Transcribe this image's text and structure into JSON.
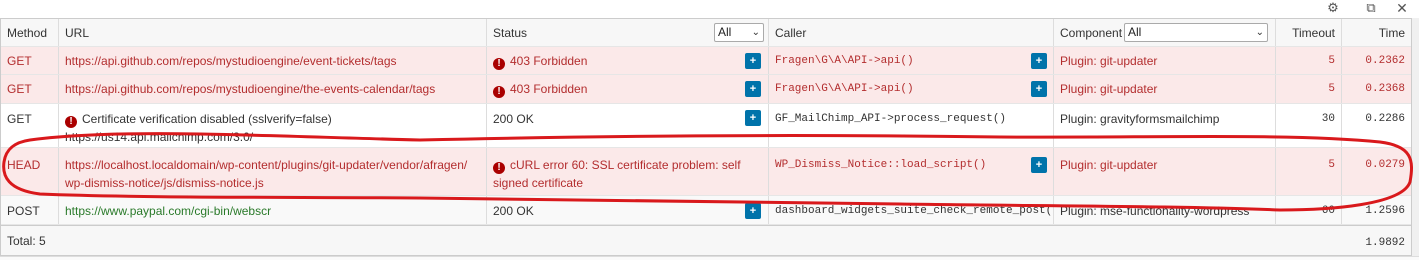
{
  "window_controls": {
    "settings": "⚙",
    "popout": "⧉",
    "close": "✕"
  },
  "columns": {
    "method": "Method",
    "url": "URL",
    "status": "Status",
    "status_filter": "All",
    "caller": "Caller",
    "component": "Component",
    "component_filter": "All",
    "timeout": "Timeout",
    "time": "Time"
  },
  "rows": [
    {
      "method": "GET",
      "url": "https://api.github.com/repos/mystudioengine/event-tickets/tags",
      "status": "403 Forbidden",
      "caller": "Fragen\\G\\A\\API->api()",
      "component": "Plugin: git-updater",
      "timeout": "5",
      "time": "0.2362"
    },
    {
      "method": "GET",
      "url": "https://api.github.com/repos/mystudioengine/the-events-calendar/tags",
      "status": "403 Forbidden",
      "caller": "Fragen\\G\\A\\API->api()",
      "component": "Plugin: git-updater",
      "timeout": "5",
      "time": "0.2368"
    },
    {
      "method": "GET",
      "url_warning": "Certificate verification disabled (sslverify=false)",
      "url": "https://us14.api.mailchimp.com/3.0/",
      "status": "200 OK",
      "caller": "GF_MailChimp_API->process_request()",
      "component": "Plugin: gravityformsmailchimp",
      "timeout": "30",
      "time": "0.2286"
    },
    {
      "method": "HEAD",
      "url_line1": "https://localhost.localdomain/wp-content/plugins/git-updater/vendor/afragen/",
      "url_line2": "wp-dismiss-notice/js/dismiss-notice.js",
      "status_line1": "cURL error 60: SSL certificate problem: self",
      "status_line2": "signed certificate",
      "caller": "WP_Dismiss_Notice::load_script()",
      "component": "Plugin: git-updater",
      "timeout": "5",
      "time": "0.0279"
    },
    {
      "method": "POST",
      "url": "https://www.paypal.com/cgi-bin/webscr",
      "status": "200 OK",
      "caller": "dashboard_widgets_suite_check_remote_post()",
      "component": "Plugin: mse-functionality-wordpress",
      "timeout": "60",
      "time": "1.2596"
    }
  ],
  "total": {
    "label": "Total: 5",
    "time": "1.9892"
  },
  "icons": {
    "plus": "+",
    "warning": "!",
    "dropdown": "⌄"
  },
  "colors": {
    "error_bg": "#fbe9e9",
    "error_text": "#b32d2e",
    "button_blue": "#0073aa",
    "annotation_red": "#d9191c"
  }
}
